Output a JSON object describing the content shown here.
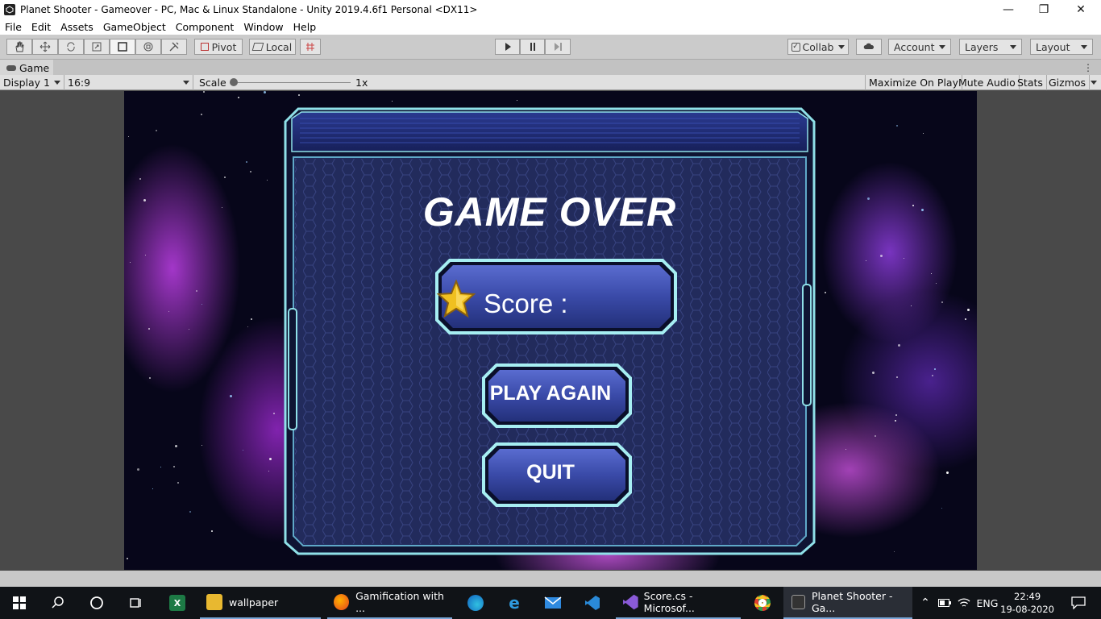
{
  "window": {
    "title": "Planet Shooter - Gameover - PC, Mac & Linux Standalone - Unity 2019.4.6f1 Personal <DX11>",
    "minimize": "—",
    "maximize": "❐",
    "close": "✕"
  },
  "menu": [
    "File",
    "Edit",
    "Assets",
    "GameObject",
    "Component",
    "Window",
    "Help"
  ],
  "toolbar": {
    "pivot_label": "Pivot",
    "local_label": "Local",
    "collab_label": "Collab",
    "account_label": "Account",
    "layers_label": "Layers",
    "layout_label": "Layout"
  },
  "game_tab": {
    "label": "Game",
    "display": "Display 1",
    "aspect": "16:9",
    "scale_label": "Scale",
    "scale_value": "1x",
    "maximize_on_play": "Maximize On Play",
    "mute_audio": "Mute Audio",
    "stats": "Stats",
    "gizmos": "Gizmos"
  },
  "game": {
    "title": "GAME OVER",
    "score_label": "Score :",
    "play_again": "PLAY AGAIN",
    "quit": "QUIT"
  },
  "taskbar": {
    "items": [
      {
        "label": "wallpaper"
      },
      {
        "label": "Gamification with ..."
      },
      {
        "label": "Score.cs - Microsof..."
      },
      {
        "label": "Planet Shooter - Ga..."
      }
    ],
    "language": "ENG",
    "time": "22:49",
    "date": "19-08-2020"
  },
  "colors": {
    "panel_border": "#8fe0e8",
    "panel_fill": "#2a3466",
    "button_fill": "#3a4aa0",
    "taskbar": "#101317"
  }
}
